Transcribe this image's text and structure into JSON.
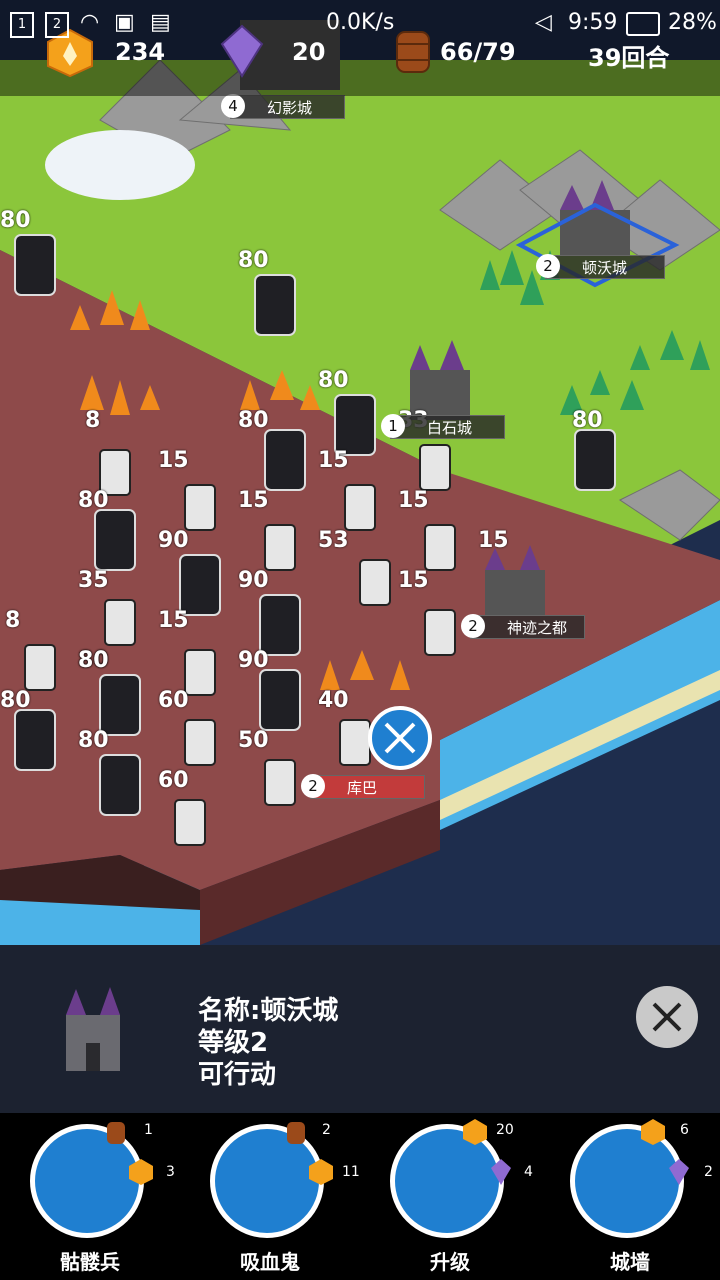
{
  "status_bar": {
    "sim1": "1",
    "sim2": "2",
    "speed": "0.0K/s",
    "time": "9:59",
    "battery": "28%"
  },
  "resources": {
    "gold": "234",
    "crystal": "20",
    "barrel": "66/79",
    "turn": "39回合"
  },
  "cities": [
    {
      "level": "4",
      "name": "幻影城"
    },
    {
      "level": "2",
      "name": "顿沃城"
    },
    {
      "level": "1",
      "name": "白石城"
    },
    {
      "level": "2",
      "name": "神迹之都"
    },
    {
      "level": "2",
      "name": "库巴"
    }
  ],
  "hp_labels": [
    "80",
    "80",
    "80",
    "8",
    "80",
    "80",
    "15",
    "15",
    "80",
    "15",
    "15",
    "15",
    "90",
    "53",
    "15",
    "90",
    "15",
    "35",
    "8",
    "80",
    "60",
    "90",
    "40",
    "80",
    "50",
    "80",
    "60",
    "33",
    "80"
  ],
  "info_panel": {
    "name": "名称:顿沃城",
    "level": "等级2",
    "status": "可行动"
  },
  "actions": [
    {
      "label": "骷髅兵",
      "cost_top": "1",
      "cost_right": "3"
    },
    {
      "label": "吸血鬼",
      "cost_top": "2",
      "cost_right": "11"
    },
    {
      "label": "升级",
      "cost_top": "20",
      "cost_right": "4"
    },
    {
      "label": "城墙",
      "cost_top": "6",
      "cost_right": "2"
    }
  ],
  "colors": {
    "grass": "#8bc63b",
    "enemy_territory": "#8e4a4a",
    "water": "#4cb3e8",
    "deep_water": "#1e2d4d",
    "panel_bg": "#1c2230",
    "action_circle": "#1f7fd0",
    "enemy_label": "#c23b3b"
  },
  "icons": {
    "status": [
      "sim-icon",
      "wifi-icon",
      "image-icon",
      "sdcard-icon",
      "mute-icon",
      "battery-icon"
    ],
    "resources": [
      "gold-hexagon-icon",
      "crystal-icon",
      "barrel-icon"
    ],
    "info": [
      "castle-icon",
      "close-icon"
    ],
    "actions": [
      "skeleton-unit-icon",
      "vampire-unit-icon",
      "castle-upgrade-icon",
      "wall-icon"
    ],
    "map": [
      "attack-swords-icon"
    ]
  }
}
